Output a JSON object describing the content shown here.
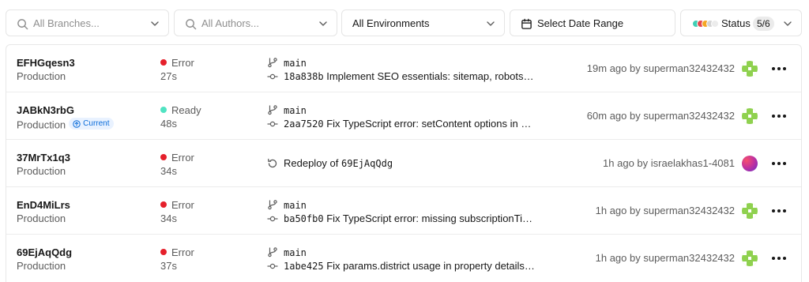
{
  "filters": {
    "branches_placeholder": "All Branches...",
    "authors_placeholder": "All Authors...",
    "environments_label": "All Environments",
    "date_label": "Select Date Range",
    "status_label": "Status",
    "status_count": "5/6",
    "status_colors": [
      "#3fcfb4",
      "#e5484d",
      "#f5a623",
      "#d4d4d4",
      "#ececec"
    ]
  },
  "colors": {
    "error": "#e5202b",
    "ready": "#50e3c2",
    "current_badge_text": "#0a6cda",
    "avatar_green": "#8fd14f"
  },
  "deployments": [
    {
      "id": "EFHGqesn3",
      "environment": "Production",
      "status": "Error",
      "status_color": "#e5202b",
      "duration": "27s",
      "branch": "main",
      "commit_sha": "18a838b",
      "commit_message": "Implement SEO essentials: sitemap, robots.tx...",
      "meta": "19m ago by superman32432432",
      "avatar": "green-pixel-avatar"
    },
    {
      "id": "JABkN3rbG",
      "environment": "Production",
      "current_label": "Current",
      "status": "Ready",
      "status_color": "#50e3c2",
      "duration": "48s",
      "branch": "main",
      "commit_sha": "2aa7520",
      "commit_message": "Fix TypeScript error: setContent options in Ric...",
      "meta": "60m ago by superman32432432",
      "avatar": "green-pixel-avatar"
    },
    {
      "id": "37MrTx1q3",
      "environment": "Production",
      "status": "Error",
      "status_color": "#e5202b",
      "duration": "34s",
      "redeploy_label": "Redeploy of",
      "redeploy_ref": "69EjAqQdg",
      "meta": "1h ago by israelakhas1-4081",
      "avatar": "gradient-avatar"
    },
    {
      "id": "EnD4MiLrs",
      "environment": "Production",
      "status": "Error",
      "status_color": "#e5202b",
      "duration": "34s",
      "branch": "main",
      "commit_sha": "ba50fb0",
      "commit_message": "Fix TypeScript error: missing subscriptionTier ...",
      "meta": "1h ago by superman32432432",
      "avatar": "green-pixel-avatar"
    },
    {
      "id": "69EjAqQdg",
      "environment": "Production",
      "status": "Error",
      "status_color": "#e5202b",
      "duration": "37s",
      "branch": "main",
      "commit_sha": "1abe425",
      "commit_message": "Fix params.district usage in property details p...",
      "meta": "1h ago by superman32432432",
      "avatar": "green-pixel-avatar"
    }
  ]
}
